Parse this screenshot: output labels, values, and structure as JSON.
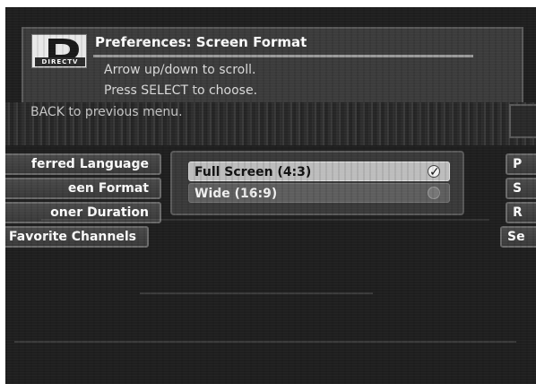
{
  "header": {
    "logo_text": "DIRECTV",
    "title": "Preferences: Screen Format",
    "instructions": [
      "Arrow up/down to scroll.",
      "Press SELECT to choose.",
      "BACK to previous menu."
    ]
  },
  "left_menu": {
    "items": [
      {
        "label": "ferred Language"
      },
      {
        "label": "een Format"
      },
      {
        "label": "oner Duration"
      },
      {
        "label": "Favorite Channels"
      }
    ]
  },
  "options_popup": {
    "options": [
      {
        "label": "Full Screen (4:3)",
        "selected": true
      },
      {
        "label": "Wide (16:9)",
        "selected": false
      }
    ],
    "check_glyph": "✓"
  },
  "right_menu": {
    "items": [
      {
        "label": "P"
      },
      {
        "label": "S"
      },
      {
        "label": "R"
      },
      {
        "label": "Se"
      }
    ]
  },
  "colors": {
    "background": "#1f1f1f",
    "panel": "#3c3c3c",
    "selected_option": "#bdbdbd"
  },
  "icons": {
    "logo": "directv-logo-icon",
    "selected_radio": "radio-checked-icon",
    "unselected_radio": "radio-unchecked-icon"
  }
}
